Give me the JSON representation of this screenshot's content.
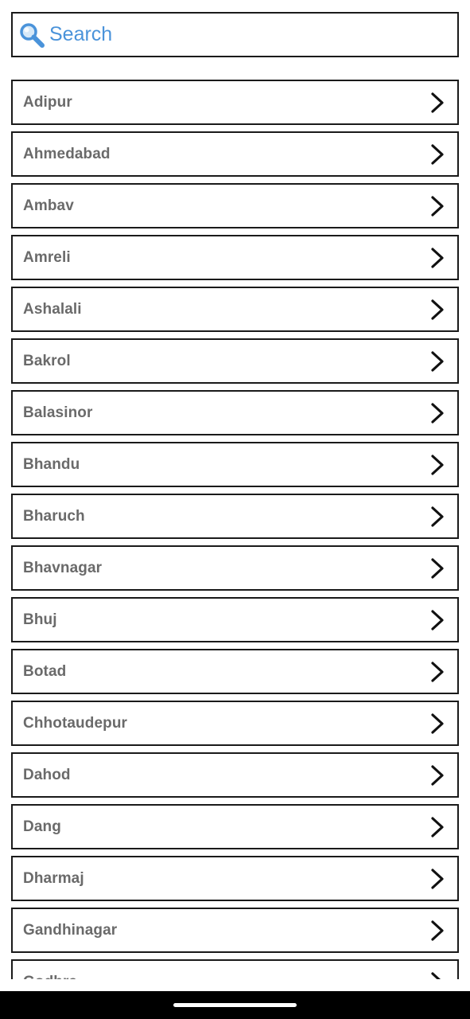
{
  "search": {
    "placeholder": "Search",
    "icon": "magnifier-icon",
    "accent_color": "#4a93da"
  },
  "cities": [
    {
      "label": "Adipur"
    },
    {
      "label": "Ahmedabad"
    },
    {
      "label": "Ambav"
    },
    {
      "label": "Amreli"
    },
    {
      "label": "Ashalali"
    },
    {
      "label": "Bakrol"
    },
    {
      "label": "Balasinor"
    },
    {
      "label": "Bhandu"
    },
    {
      "label": "Bharuch"
    },
    {
      "label": "Bhavnagar"
    },
    {
      "label": "Bhuj"
    },
    {
      "label": "Botad"
    },
    {
      "label": "Chhotaudepur"
    },
    {
      "label": "Dahod"
    },
    {
      "label": "Dang"
    },
    {
      "label": "Dharmaj"
    },
    {
      "label": "Gandhinagar"
    },
    {
      "label": "Godhra"
    }
  ],
  "row_icon": "chevron-right-icon"
}
